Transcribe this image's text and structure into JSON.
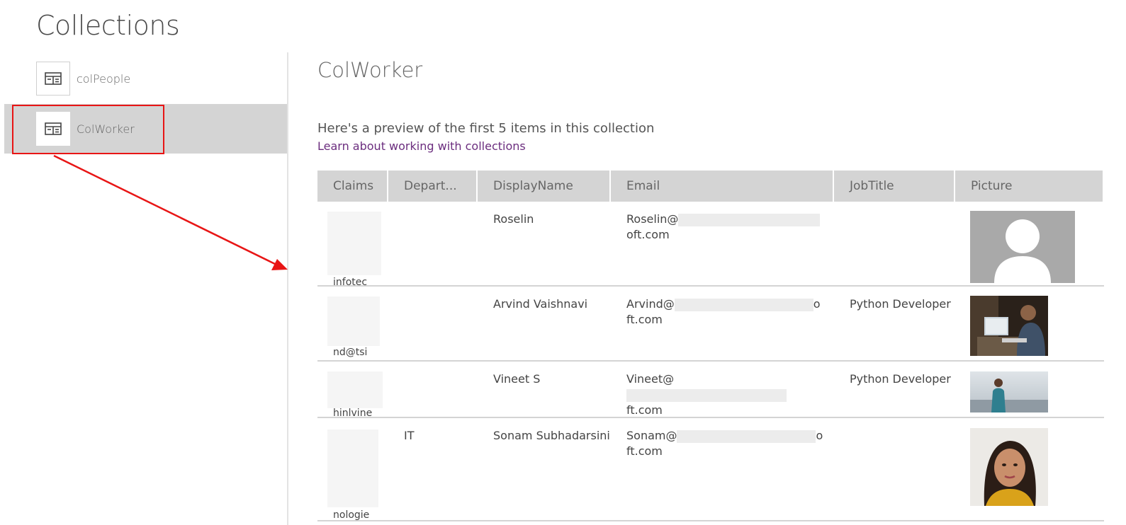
{
  "page": {
    "title": "Collections"
  },
  "sidebar": {
    "items": [
      {
        "label": "colPeople"
      },
      {
        "label": "ColWorker"
      }
    ]
  },
  "main": {
    "collection_title": "ColWorker",
    "preview_text": "Here's a preview of the first 5 items in this collection",
    "learn_link": "Learn about working with collections"
  },
  "table": {
    "headers": [
      "Claims",
      "Depart...",
      "DisplayName",
      "Email",
      "JobTitle",
      "Picture"
    ],
    "rows": [
      {
        "claims": "infotec",
        "department": "",
        "display_name": "Roselin",
        "email_start": "Roselin@",
        "email_end": "",
        "email_line2": "oft.com",
        "job_title": ""
      },
      {
        "claims": "nd@tsi",
        "department": "",
        "display_name": "Arvind Vaishnavi",
        "email_start": "Arvind@",
        "email_end": "o",
        "email_line2": "ft.com",
        "job_title": "Python Developer"
      },
      {
        "claims": "hinlvine",
        "department": "",
        "display_name": "Vineet S",
        "email_start": "Vineet@",
        "email_end": "",
        "email_line2": "ft.com",
        "job_title": "Python Developer"
      },
      {
        "claims": "nologie",
        "department": "IT",
        "display_name": "Sonam Subhadarsini",
        "email_start": "Sonam@",
        "email_end": "o",
        "email_line2": "ft.com",
        "job_title": ""
      }
    ]
  },
  "colors": {
    "accent_link": "#6b2d7e",
    "highlight": "#e81515",
    "selected_bg": "#d4d4d4"
  }
}
